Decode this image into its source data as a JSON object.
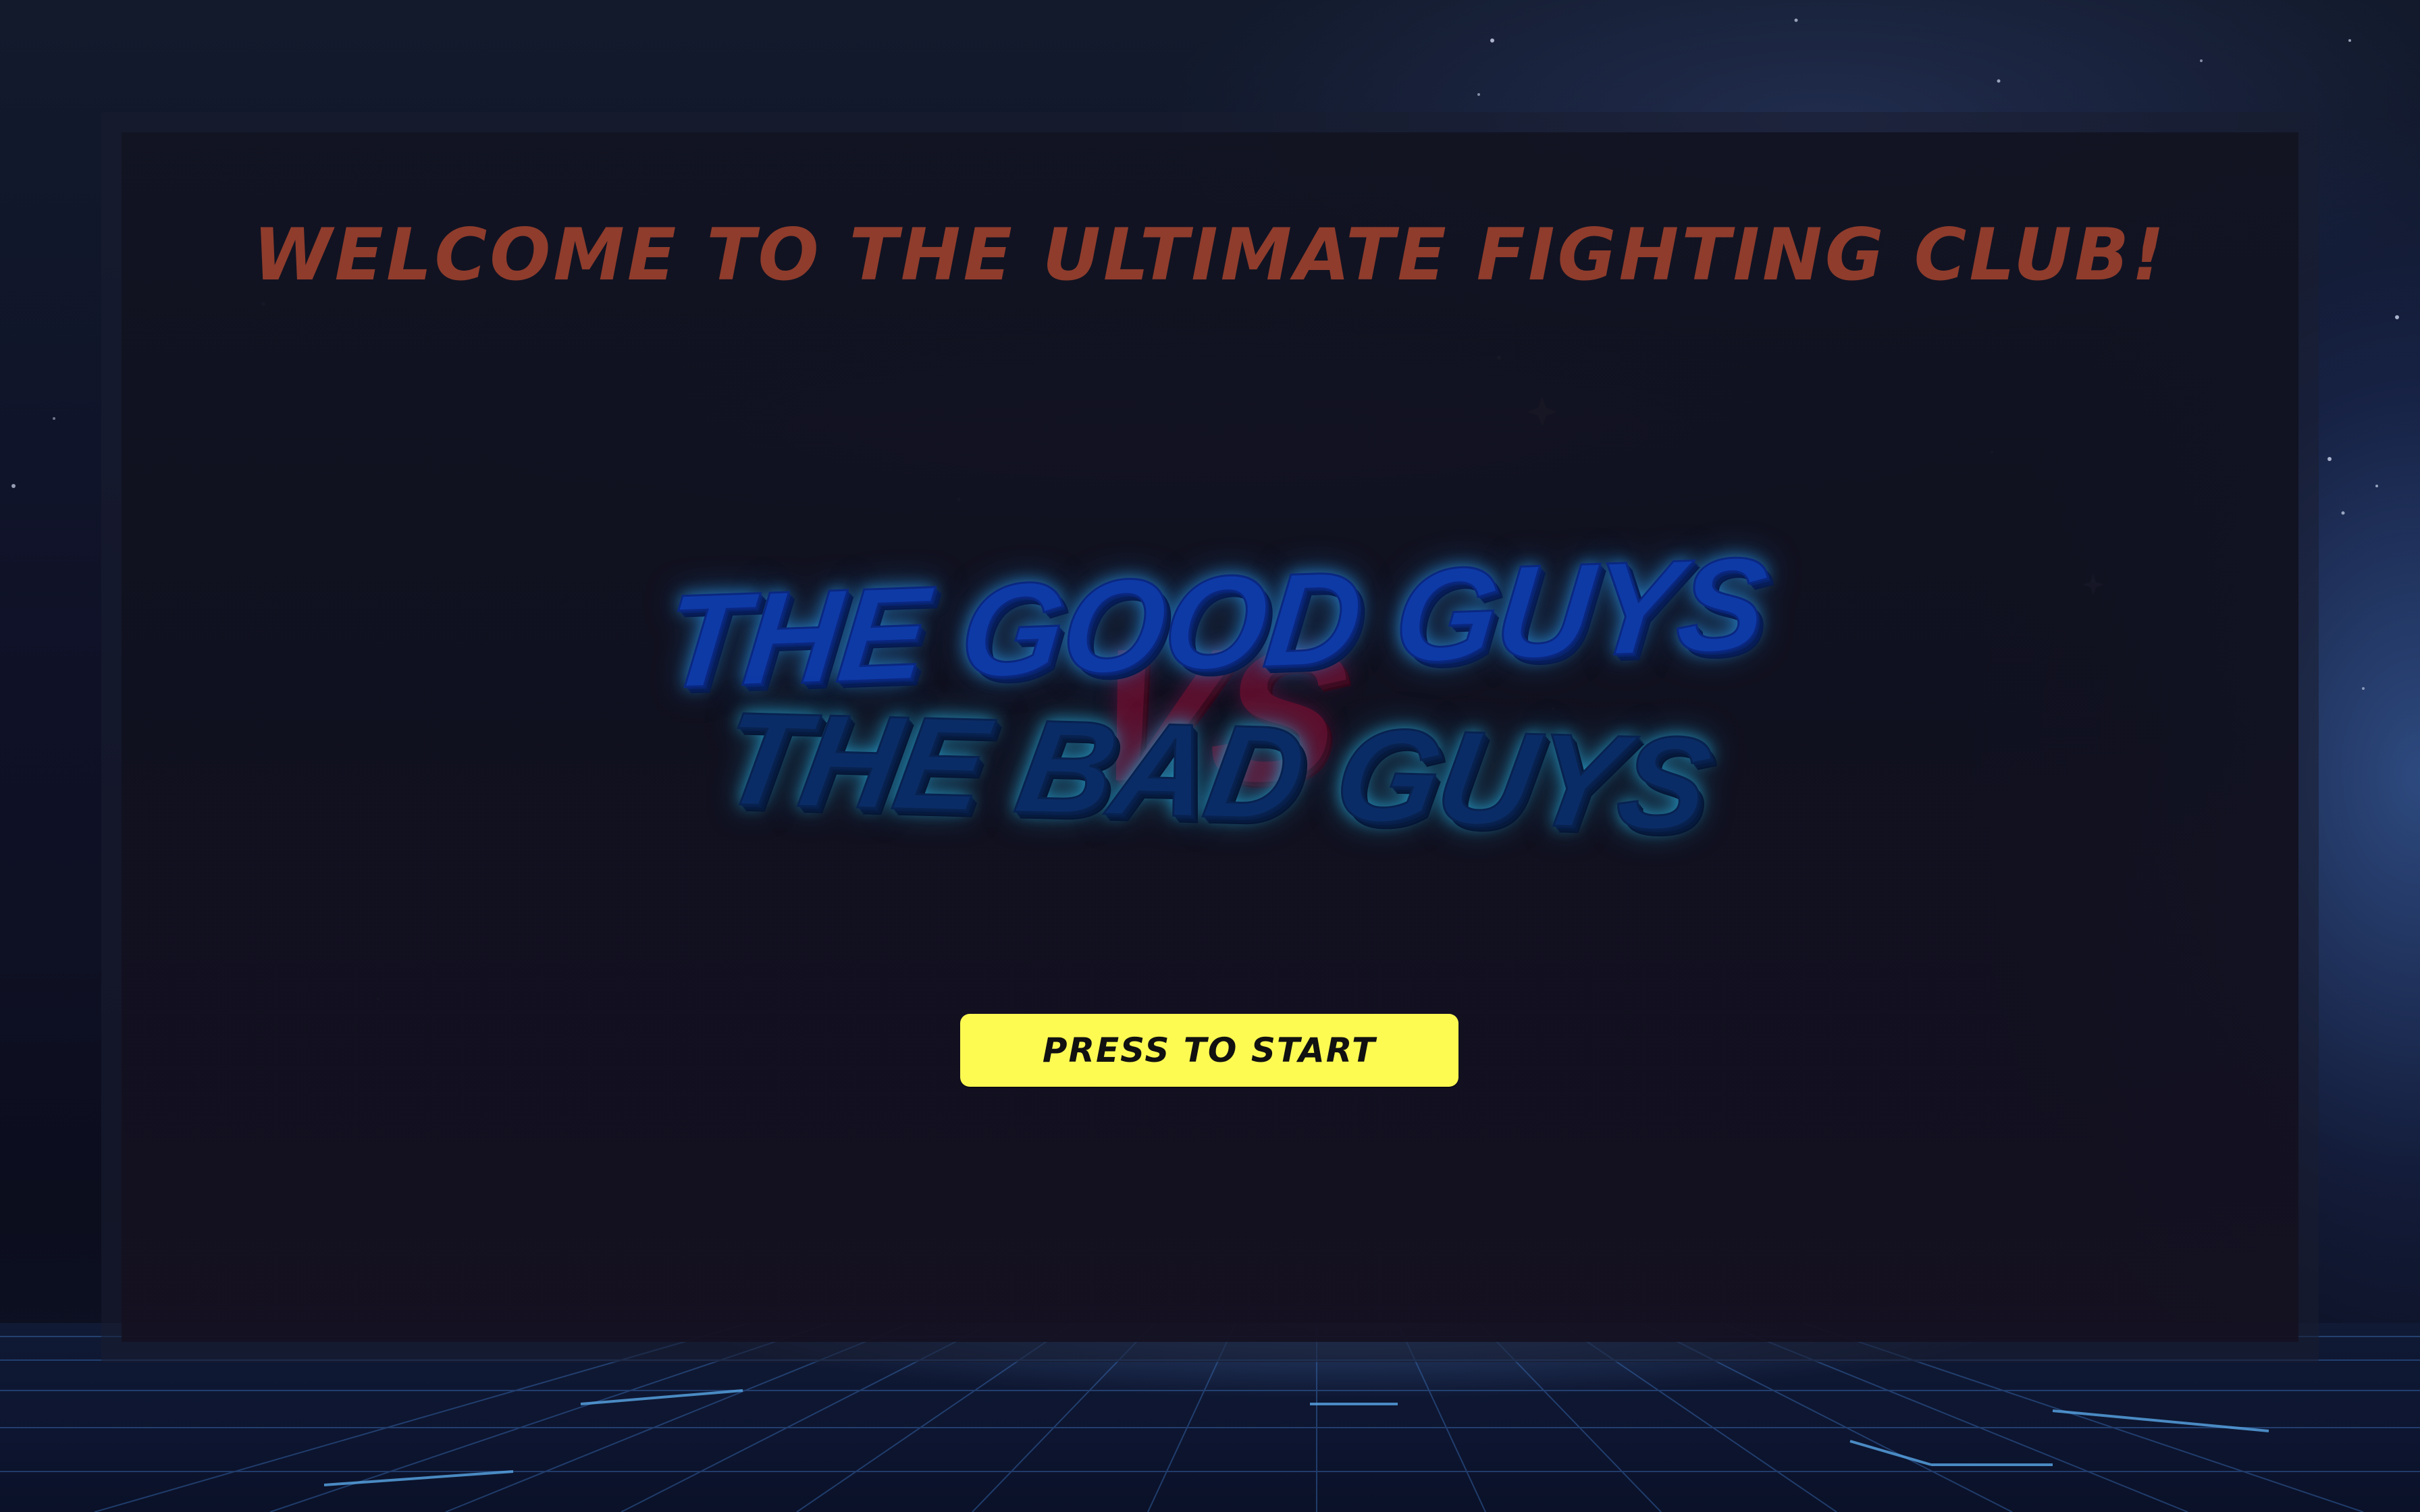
{
  "screen": {
    "welcome_text": "WELCOME TO THE ULTIMATE FIGHTING CLUB!",
    "logo": {
      "line1": "THE GOOD GUYS",
      "versus": "VS",
      "line2": "THE BAD GUYS"
    },
    "start_button_label": "PRESS TO START"
  },
  "colors": {
    "welcome_text": "#8f3c2c",
    "good_guys": "#0e3aa6",
    "bad_guys": "#0a2c66",
    "versus": "#5c0f2c",
    "start_button_bg": "#fdfa52",
    "start_button_text": "#111111",
    "background": "#0e1024"
  }
}
